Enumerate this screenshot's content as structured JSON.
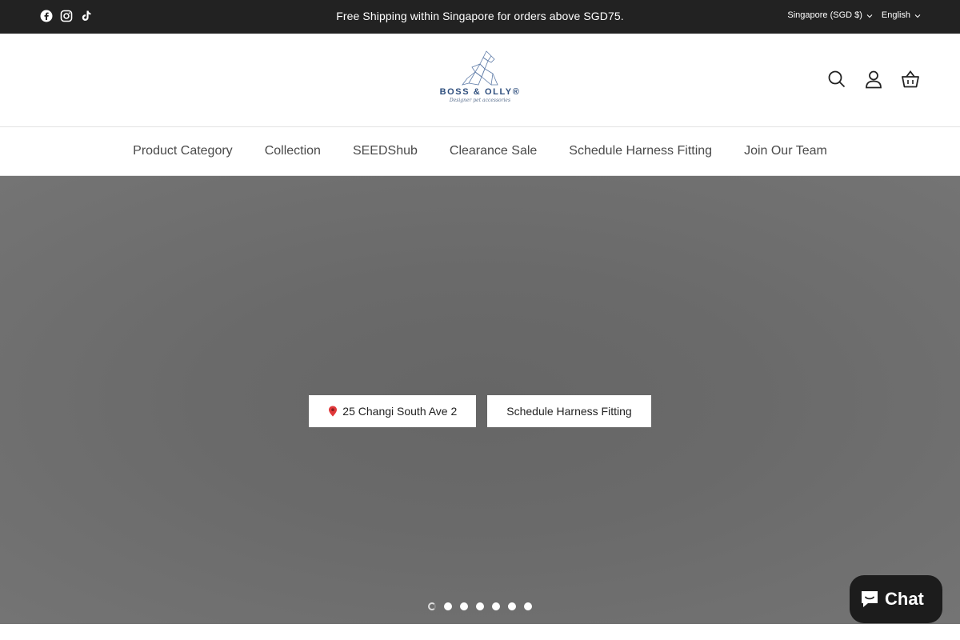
{
  "announcement": {
    "text": "Free Shipping within Singapore for orders above SGD75.",
    "social": [
      "facebook-icon",
      "instagram-icon",
      "tiktok-icon"
    ],
    "country": "Singapore (SGD $)",
    "language": "English"
  },
  "header": {
    "logo_text": "BOSS & OLLY",
    "logo_mark": "®",
    "logo_tagline": "Designer pet accessories",
    "icons": [
      "search-icon",
      "account-icon",
      "cart-icon"
    ]
  },
  "nav": {
    "items": [
      "Product Category",
      "Collection",
      "SEEDShub",
      "Clearance Sale",
      "Schedule Harness Fitting",
      "Join Our Team"
    ]
  },
  "hero": {
    "buttons": [
      {
        "label": "25 Changi South Ave 2",
        "icon": "map-pin-icon"
      },
      {
        "label": "Schedule Harness Fitting"
      }
    ],
    "slides": 7,
    "active_slide": 1
  },
  "chat": {
    "label": "Chat"
  },
  "colors": {
    "topbar": "#222222",
    "hero_overlay": "#6b6b6b",
    "brand": "#2f4f7e",
    "chat_bg": "#1c1c1c"
  }
}
